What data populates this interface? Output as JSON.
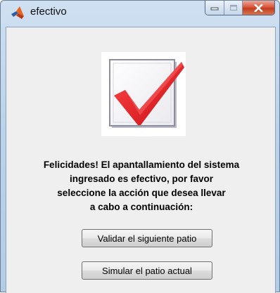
{
  "window": {
    "title": "efectivo",
    "icon": "matlab-logo-icon"
  },
  "controls": {
    "minimize": "minimize-icon",
    "maximize": "maximize-icon",
    "close": "close-icon"
  },
  "content": {
    "image": "checkmark-icon",
    "message_lines": [
      "Felicidades! El apantallamiento del sistema",
      "ingresado es efectivo, por favor",
      "seleccione la acción que desea llevar",
      "a cabo a continuación:"
    ]
  },
  "buttons": {
    "validar": "Validar el siguiente patio",
    "simular": "Simular el patio actual"
  },
  "colors": {
    "check_red": "#e0141a",
    "close_button": "#c94a2c",
    "client_background": "#efefef"
  }
}
